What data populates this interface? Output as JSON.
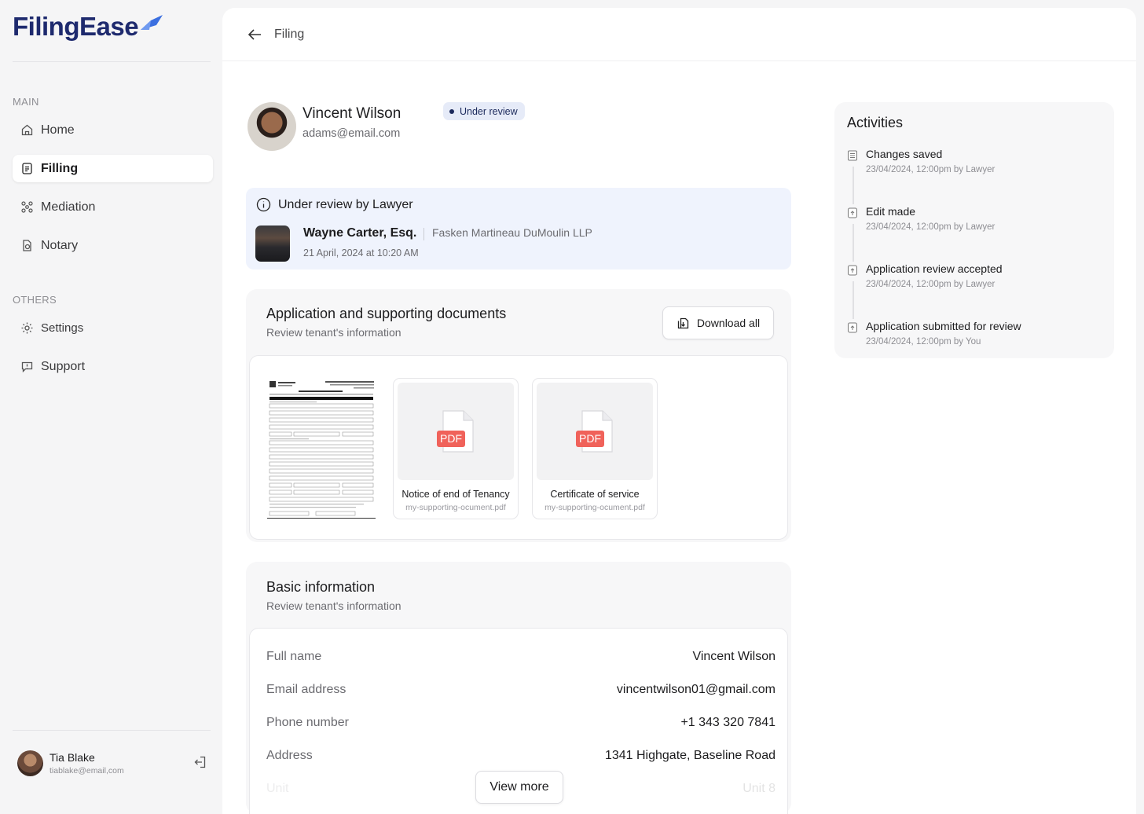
{
  "brand": {
    "name_part1": "Filing",
    "name_part2": "Ease",
    "color": "#1e2a6e",
    "accent": "#3b6fe0"
  },
  "sidebar": {
    "main_label": "MAIN",
    "others_label": "OTHERS",
    "items": [
      {
        "label": "Home",
        "icon": "home-icon"
      },
      {
        "label": "Filling",
        "icon": "document-icon",
        "active": true
      },
      {
        "label": "Mediation",
        "icon": "mediation-icon"
      },
      {
        "label": "Notary",
        "icon": "notary-icon"
      }
    ],
    "others": [
      {
        "label": "Settings",
        "icon": "gear-icon"
      },
      {
        "label": "Support",
        "icon": "support-icon"
      }
    ],
    "user": {
      "name": "Tia Blake",
      "email": "tiablake@email,com"
    }
  },
  "topbar": {
    "title": "Filing"
  },
  "profile": {
    "name": "Vincent Wilson",
    "email": "adams@email.com",
    "status": "Under review"
  },
  "review": {
    "heading": "Under review by Lawyer",
    "lawyer_name": "Wayne Carter, Esq.",
    "firm": "Fasken Martineau DuMoulin LLP",
    "date": "21 April, 2024 at 10:20 AM"
  },
  "documents": {
    "title": "Application and supporting documents",
    "subtitle": "Review tenant's information",
    "download_label": "Download all",
    "files": [
      {
        "name": "Notice of end of Tenancy",
        "file": "my-supporting-ocument.pdf",
        "badge": "PDF"
      },
      {
        "name": "Certificate of service",
        "file": "my-supporting-ocument.pdf",
        "badge": "PDF"
      }
    ]
  },
  "basic": {
    "title": "Basic information",
    "subtitle": "Review tenant's information",
    "rows": [
      {
        "label": "Full name",
        "value": "Vincent Wilson"
      },
      {
        "label": "Email address",
        "value": "vincentwilson01@gmail.com"
      },
      {
        "label": "Phone number",
        "value": "+1 343 320 7841"
      },
      {
        "label": "Address",
        "value": "1341 Highgate, Baseline Road"
      },
      {
        "label": "Unit",
        "value": "Unit 8"
      }
    ],
    "view_more": "View more"
  },
  "activities": {
    "title": "Activities",
    "items": [
      {
        "title": "Changes saved",
        "meta": "23/04/2024, 12:00pm by Lawyer",
        "icon": "list-icon"
      },
      {
        "title": "Edit made",
        "meta": "23/04/2024, 12:00pm by Lawyer",
        "icon": "upload-icon"
      },
      {
        "title": "Application review accepted",
        "meta": "23/04/2024, 12:00pm by Lawyer",
        "icon": "upload-icon"
      },
      {
        "title": "Application submitted for review",
        "meta": "23/04/2024, 12:00pm by You",
        "icon": "upload-icon"
      }
    ]
  }
}
